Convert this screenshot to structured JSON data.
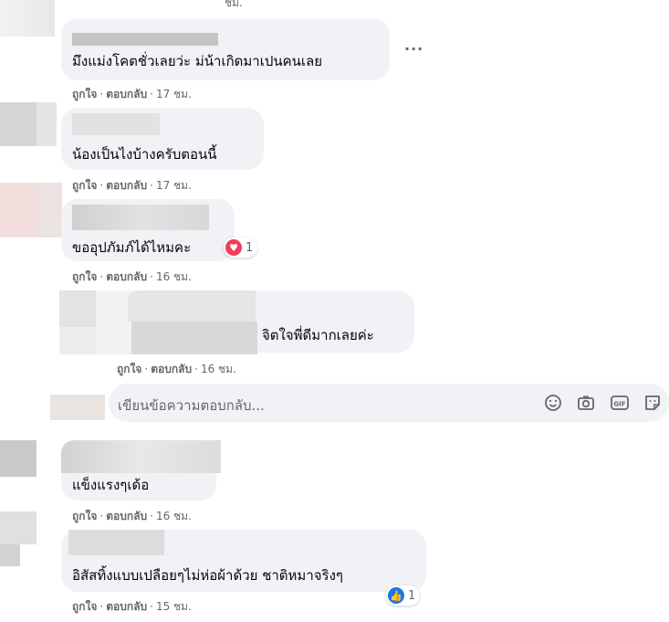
{
  "top_time": "ชม.",
  "comments": [
    {
      "text": "มึงแม่งโคตชั่วเลยว่ะ ม่น้าเกิดมาเปนคนเลย",
      "like": "ถูกใจ",
      "reply": "ตอบกลับ",
      "time": "17 ชม."
    },
    {
      "text": "น้องเป็นไงบ้างครับตอนนี้",
      "like": "ถูกใจ",
      "reply": "ตอบกลับ",
      "time": "17 ชม."
    },
    {
      "text": "ขออุปภัมภ์ได้ไหมคะ",
      "like": "ถูกใจ",
      "reply": "ตอบกลับ",
      "time": "16 ชม.",
      "reaction_count": "1"
    },
    {
      "text": "จิตใจพี่ดีมากเลยค่ะ",
      "like": "ถูกใจ",
      "reply": "ตอบกลับ",
      "time": "16 ชม."
    },
    {
      "text": "แข็งแรงๆเด้อ",
      "like": "ถูกใจ",
      "reply": "ตอบกลับ",
      "time": "16 ชม."
    },
    {
      "text": "อิสัสทิ้งแบบเปลือยๆไม่ห่อผ้าด้วย ชาติหมาจริงๆ",
      "like": "ถูกใจ",
      "reply": "ตอบกลับ",
      "time": "15 ชม.",
      "reaction_count": "1"
    }
  ],
  "more_options": "···",
  "reply_box": {
    "placeholder": "เขียนข้อความตอบกลับ...",
    "icons": [
      "emoji-icon",
      "camera-icon",
      "gif-icon",
      "sticker-icon"
    ]
  },
  "colors": {
    "bubble": "#f0f2f5",
    "meta": "#65676b",
    "like_blue": "#1877f2",
    "love_red": "#f33e58"
  }
}
